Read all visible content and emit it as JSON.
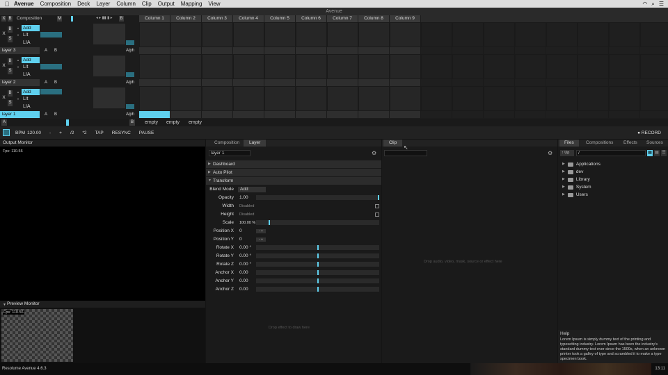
{
  "menubar": {
    "app": "Avenue",
    "items": [
      "Composition",
      "Deck",
      "Layer",
      "Column",
      "Clip",
      "Output",
      "Mapping",
      "View"
    ]
  },
  "window_title": "Avenue",
  "grid": {
    "header_left": "Composition",
    "header_m": "M",
    "header_x": "X",
    "header_b": "B",
    "header_b2": "B",
    "columns": [
      "Column 1",
      "Column 2",
      "Column 3",
      "Column 4",
      "Column 5",
      "Column 6",
      "Column 7",
      "Column 8",
      "Column 9"
    ],
    "layers": [
      {
        "name": "layer 3",
        "blend": "Add",
        "lit": "Lit",
        "lia": "LIA",
        "alph": "Alph"
      },
      {
        "name": "layer 2",
        "blend": "Add",
        "lit": "Lit",
        "lia": "LIA",
        "alph": "Alph"
      },
      {
        "name": "layer 1",
        "blend": "Add",
        "lit": "Lit",
        "lia": "LIA",
        "alph": "Alph"
      }
    ],
    "layer_btn_a": "A",
    "layer_btn_b": "B",
    "layer_x": "X",
    "layer_s": "S",
    "layer_b": "B",
    "deck_a": "A",
    "deck_b": "B",
    "decks": [
      "empty",
      "empty",
      "empty"
    ]
  },
  "transport": {
    "bpm_label": "BPM",
    "bpm_value": "120.00",
    "minus": "-",
    "plus": "+",
    "half": "/2",
    "double": "*2",
    "tap": "TAP",
    "resync": "RESYNC",
    "pause": "PAUSE",
    "record": "● RECORD"
  },
  "output_monitor": {
    "title": "Output Monitor",
    "fps": "Fps: 110.56"
  },
  "preview_monitor": {
    "title": "Preview Monitor",
    "fps": "Fps: 110.56"
  },
  "layer_panel": {
    "tabs": [
      "Composition",
      "Layer"
    ],
    "layer_name": "layer 1",
    "sections": {
      "dashboard": "Dashboard",
      "autopilot": "Auto Pilot",
      "transform": "Transform"
    },
    "blend_mode_label": "Blend Mode",
    "blend_mode_value": "Add",
    "params": [
      {
        "label": "Opacity",
        "value": "1.00",
        "mark": 1.0
      },
      {
        "label": "Width",
        "value": "Disabled"
      },
      {
        "label": "Height",
        "value": "Disabled"
      },
      {
        "label": "Scale",
        "value": "100.00 %",
        "mark": 0.1
      },
      {
        "label": "Position X",
        "value": "0"
      },
      {
        "label": "Position Y",
        "value": "0"
      },
      {
        "label": "Rotate X",
        "value": "0.00 °",
        "mark": 0.5
      },
      {
        "label": "Rotate Y",
        "value": "0.00 °",
        "mark": 0.5
      },
      {
        "label": "Rotate Z",
        "value": "0.00 °",
        "mark": 0.5
      },
      {
        "label": "Anchor X",
        "value": "0.00",
        "mark": 0.5
      },
      {
        "label": "Anchor Y",
        "value": "0.00",
        "mark": 0.5
      },
      {
        "label": "Anchor Z",
        "value": "0.00",
        "mark": 0.5
      }
    ],
    "drop_hint": "Drop effect to draw here"
  },
  "clip_panel": {
    "tab": "Clip",
    "drop_hint": "Drop audio, video, mask, source or effect here"
  },
  "browser": {
    "tabs": [
      "Files",
      "Compositions",
      "Effects",
      "Sources"
    ],
    "up_label": "Up",
    "path": "/",
    "items": [
      "Applications",
      "dev",
      "Library",
      "System",
      "Users"
    ]
  },
  "help": {
    "title": "Help",
    "text": "Lorem Ipsum is simply dummy text of the printing and typesetting industry. Lorem Ipsum has been the industry's standard dummy text ever since the 1500s, when an unknown printer took a galley of type and scrambled it to make a type specimen book."
  },
  "status": {
    "version": "Resolume Avenue 4.6.3",
    "clock": "13:11"
  },
  "colors": {
    "accent": "#5fd0ee",
    "teal": "#2a6f80"
  }
}
